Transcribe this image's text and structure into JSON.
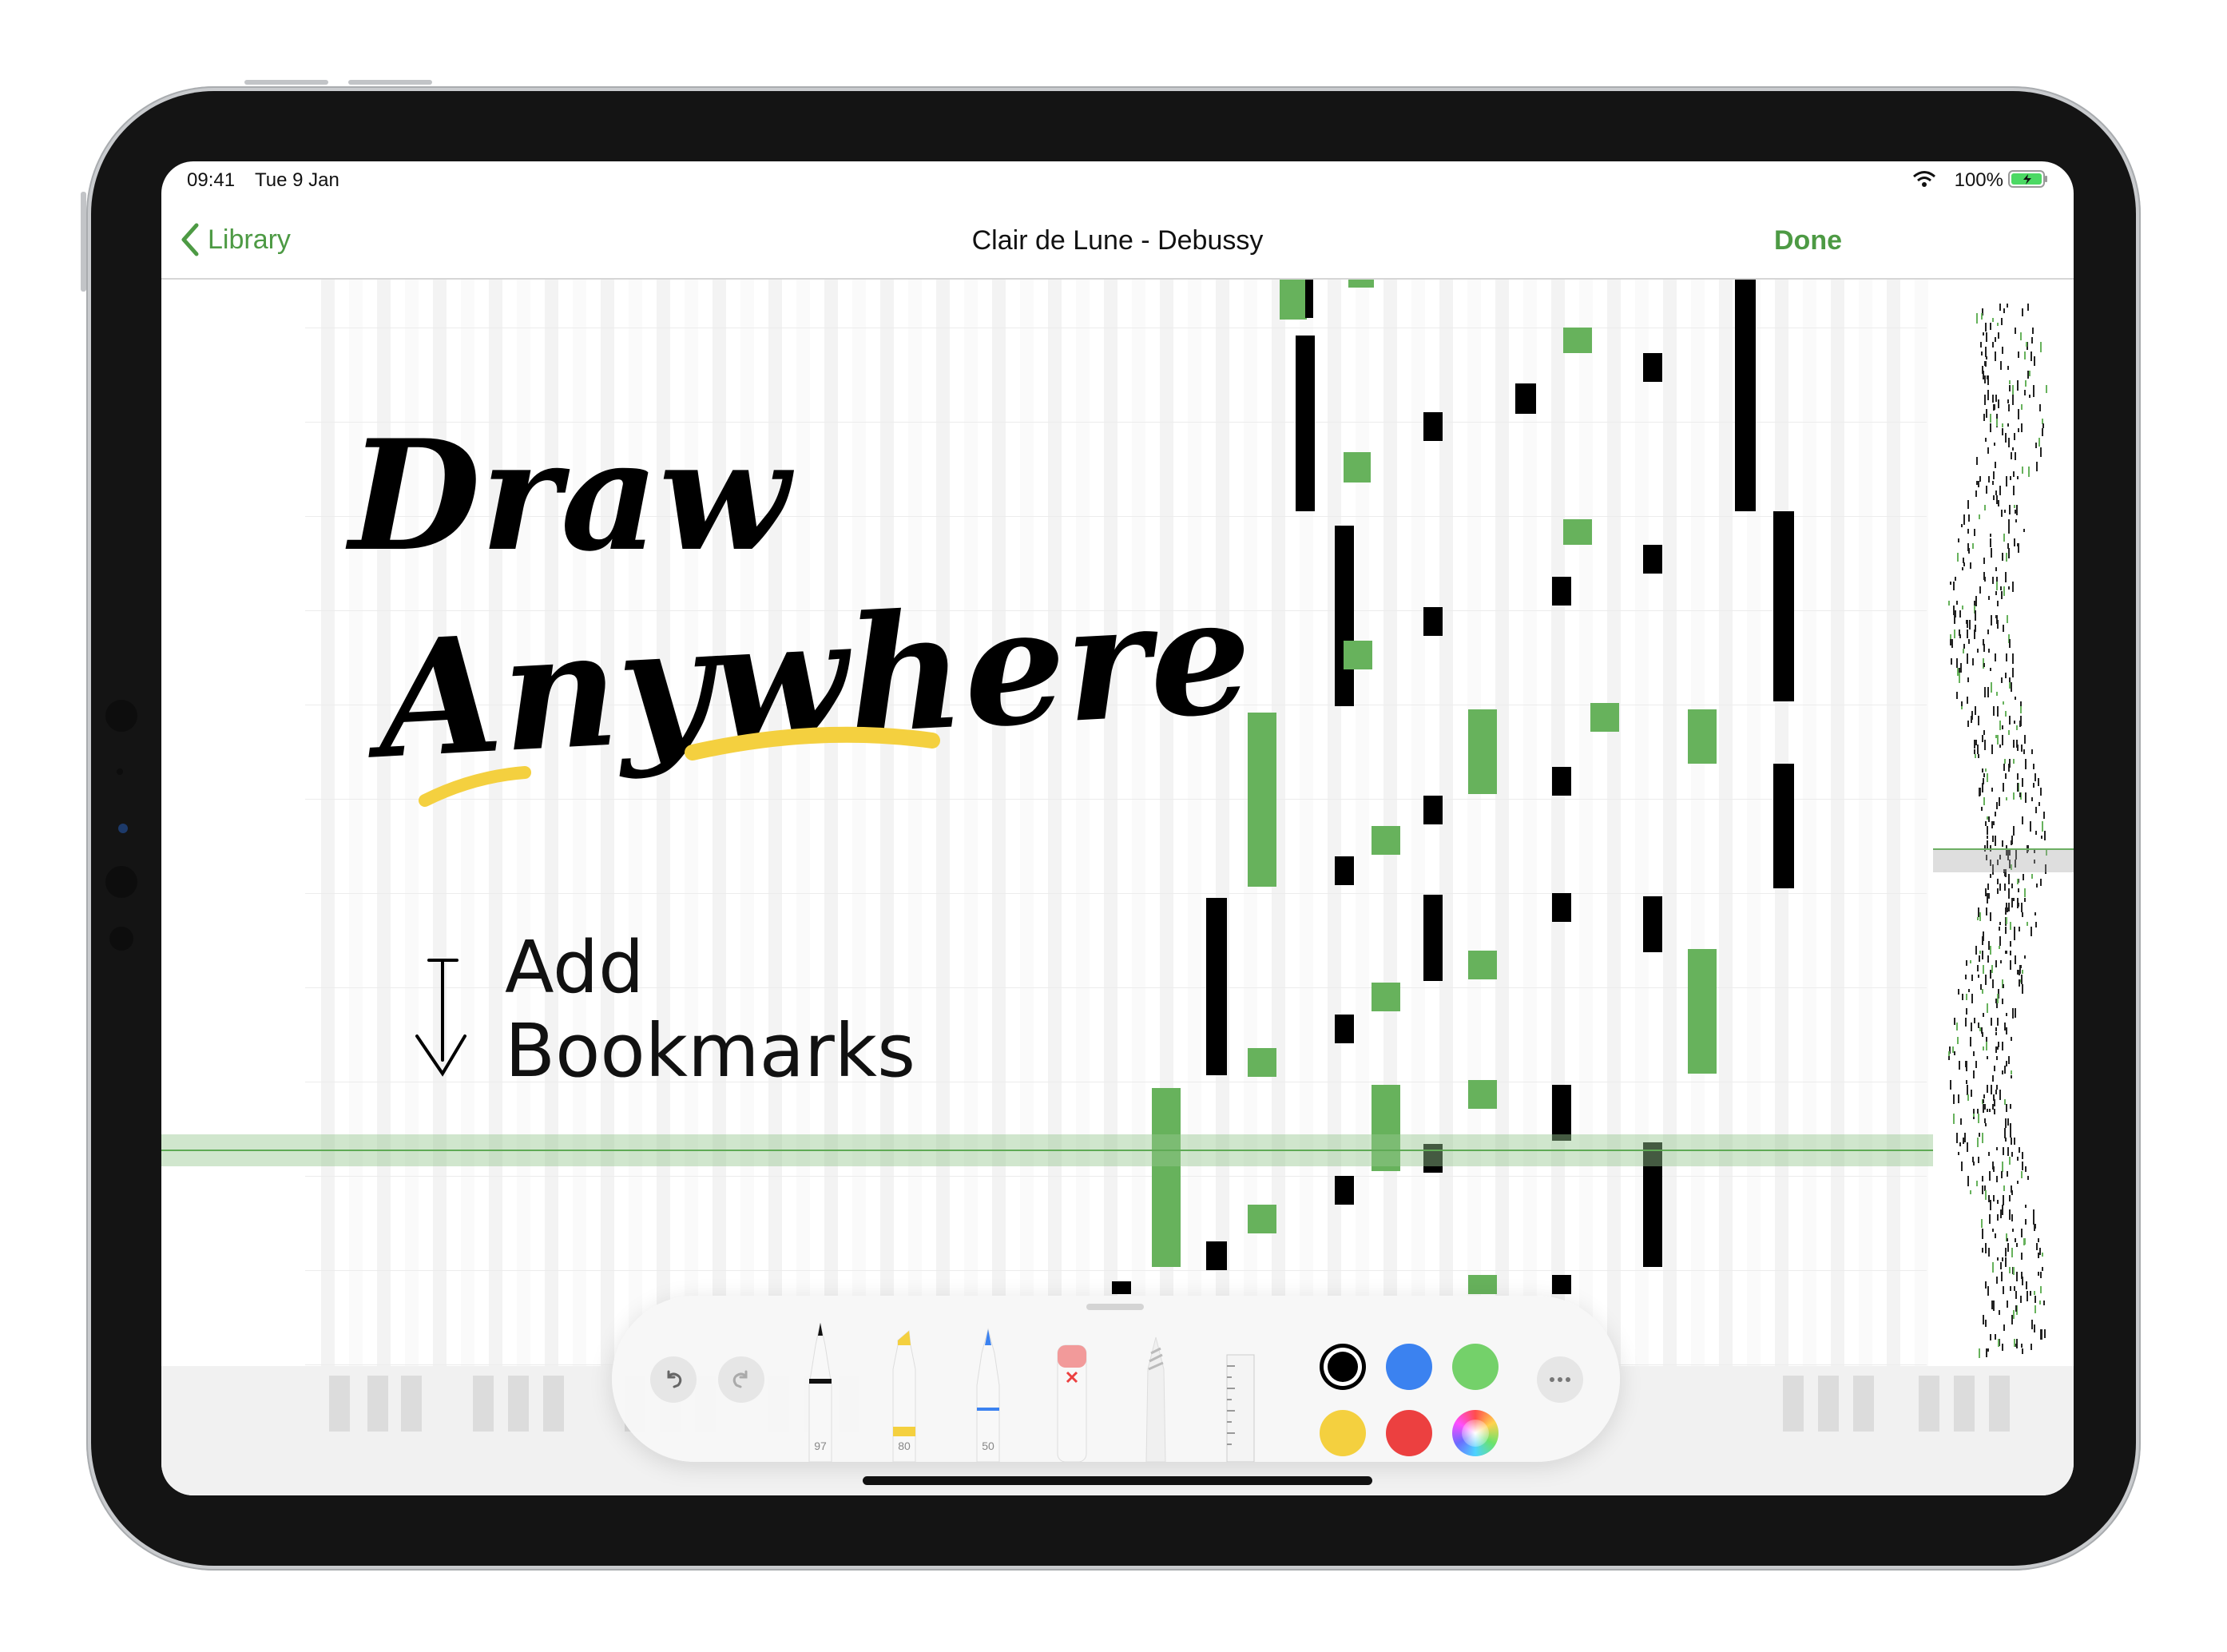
{
  "status_bar": {
    "time": "09:41",
    "date": "Tue 9 Jan",
    "battery": "100%"
  },
  "nav": {
    "back_label": "Library",
    "title": "Clair de Lune - Debussy",
    "done_label": "Done"
  },
  "handwriting": {
    "line1": "Draw",
    "line2": "Anywhere",
    "line3": "Add",
    "line4": "Bookmarks"
  },
  "tools": [
    {
      "name": "pen",
      "value": "97"
    },
    {
      "name": "highlighter",
      "value": "80"
    },
    {
      "name": "pencil",
      "value": "50"
    },
    {
      "name": "eraser",
      "value": ""
    },
    {
      "name": "lasso",
      "value": ""
    },
    {
      "name": "ruler",
      "value": ""
    }
  ],
  "colors": {
    "accent": "#4d9a44",
    "note_green": "#67b25c",
    "note_black": "#000000",
    "swatches": [
      "#000000",
      "#3b82f0",
      "#74d16a",
      "#f4d03f",
      "#ec4040",
      "spectrum"
    ]
  },
  "icons": [
    "chevron-left-icon",
    "wifi-icon",
    "battery-icon",
    "undo-icon",
    "redo-icon",
    "more-icon",
    "down-arrow-icon"
  ]
}
